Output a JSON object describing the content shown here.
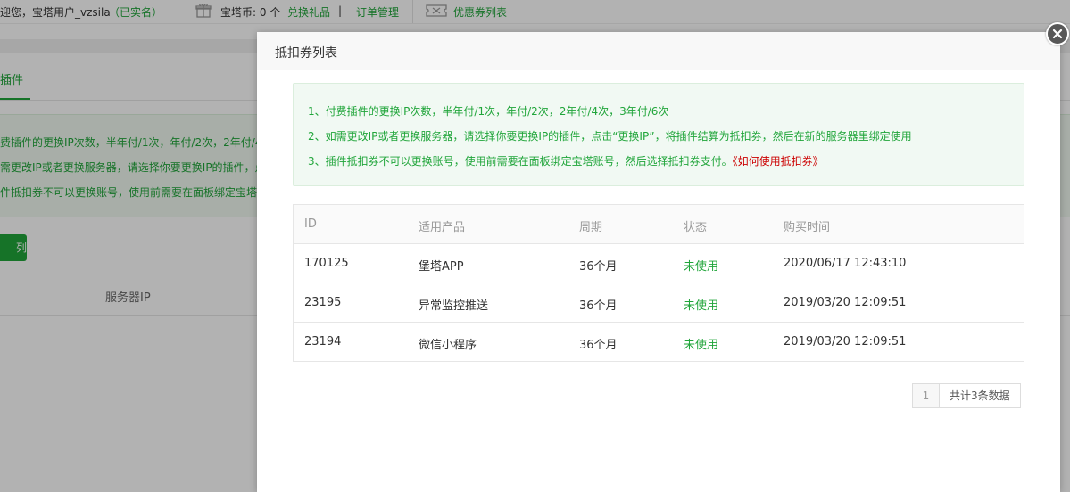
{
  "topbar": {
    "welcome": "迎您，宝塔用户_vzsila",
    "verified": "（已实名）",
    "coins": "宝塔币: 0 个",
    "exchange_gift": "兑换礼品",
    "divider": "|",
    "orders": "订单管理",
    "coupon_list": "优惠券列表"
  },
  "background": {
    "tab_label": "插件",
    "notice_lines": [
      "费插件的更换IP次数，半年付/1次，年付/2次，2年付/4",
      "需更改IP或者更换服务器，请选择你要更换IP的插件，点",
      "件抵扣券不可以更换账号，使用前需要在面板绑定宝塔账"
    ],
    "button_label": "列表",
    "column_server_ip": "服务器IP"
  },
  "modal": {
    "title": "抵扣券列表",
    "tips": [
      "1、付费插件的更换IP次数，半年付/1次，年付/2次，2年付/4次，3年付/6次",
      "2、如需更改IP或者更换服务器，请选择你要更换IP的插件，点击“更换IP”，将插件结算为抵扣券，然后在新的服务器里绑定使用",
      "3、插件抵扣券不可以更换账号，使用前需要在面板绑定宝塔账号，然后选择抵扣券支付。"
    ],
    "help_link": "《如何使用抵扣券》",
    "table": {
      "headers": {
        "id": "ID",
        "product": "适用产品",
        "period": "周期",
        "status": "状态",
        "time": "购买时间"
      },
      "rows": [
        {
          "id": "170125",
          "product": "堡塔APP",
          "period": "36个月",
          "status": "未使用",
          "time": "2020/06/17 12:43:10"
        },
        {
          "id": "23195",
          "product": "异常监控推送",
          "period": "36个月",
          "status": "未使用",
          "time": "2019/03/20 12:09:51"
        },
        {
          "id": "23194",
          "product": "微信小程序",
          "period": "36个月",
          "status": "未使用",
          "time": "2019/03/20 12:09:51"
        }
      ]
    },
    "pagination": {
      "page": "1",
      "total": "共计3条数据"
    }
  },
  "icons": {
    "close": "close-icon",
    "gift": "gift-icon",
    "coupon": "coupon-icon"
  },
  "colors": {
    "accent": "#20a53a",
    "link_red": "#cc0000"
  }
}
